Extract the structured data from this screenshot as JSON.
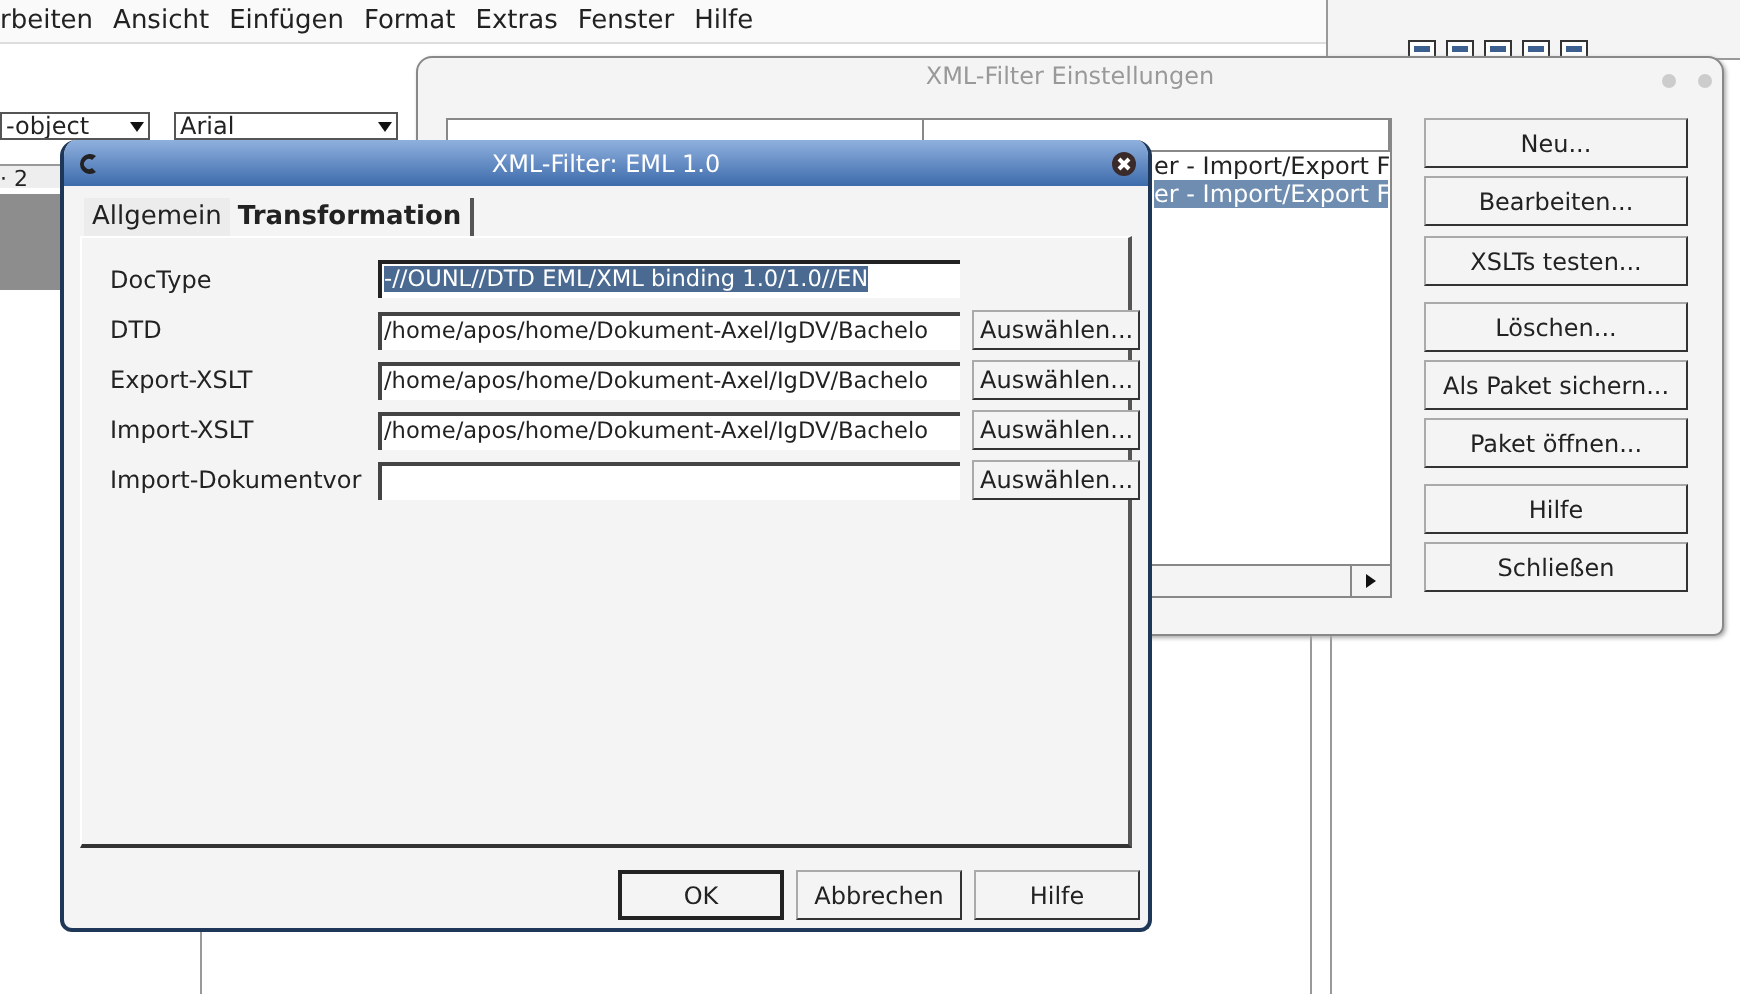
{
  "menu_bar": [
    {
      "label": "rbeiten"
    },
    {
      "label": "Ansicht"
    },
    {
      "label": "Einfügen"
    },
    {
      "label": "Format"
    },
    {
      "label": "Extras"
    },
    {
      "label": "Fenster"
    },
    {
      "label": "Hilfe"
    }
  ],
  "background_toolbar": {
    "style_box": "-object",
    "font_box": "Arial",
    "ruler": "· 2"
  },
  "filter_settings": {
    "title": "XML-Filter Einstellungen",
    "rows": [
      {
        "type": "er - Import/Export F",
        "selected": false
      },
      {
        "type": "er - Import/Export F",
        "selected": true
      }
    ],
    "buttons": [
      {
        "label": "Neu..."
      },
      {
        "label": "Bearbeiten..."
      },
      {
        "label": "XSLTs testen..."
      },
      {
        "label": "Löschen..."
      },
      {
        "label": "Als Paket sichern..."
      },
      {
        "label": "Paket öffnen..."
      },
      {
        "label": "Hilfe"
      },
      {
        "label": "Schließen"
      }
    ]
  },
  "filter_dialog": {
    "title": "XML-Filter: EML 1.0",
    "tabs": [
      {
        "label": "Allgemein",
        "selected": false
      },
      {
        "label": "Transformation",
        "selected": true
      }
    ],
    "fields": [
      {
        "label": "DocType",
        "value": "-//OUNL//DTD EML/XML binding 1.0/1.0//EN",
        "selected": true
      },
      {
        "label": "DTD",
        "value": "/home/apos/home/Dokument-Axel/IgDV/Bachelo",
        "selected": false,
        "button": {
          "label": "Auswählen..."
        }
      },
      {
        "label": "Export-XSLT",
        "value": "/home/apos/home/Dokument-Axel/IgDV/Bachelo",
        "selected": false,
        "button": {
          "label": "Auswählen..."
        }
      },
      {
        "label": "Import-XSLT",
        "value": "/home/apos/home/Dokument-Axel/IgDV/Bachelo",
        "selected": false,
        "button": {
          "label": "Auswählen..."
        }
      },
      {
        "label": "Import-Dokumentvor",
        "selected": false,
        "button": {
          "label": "Auswählen..."
        }
      }
    ],
    "buttons": [
      {
        "label": "OK",
        "default": true
      },
      {
        "label": "Abbrechen",
        "default": false
      },
      {
        "label": "Hilfe",
        "default": false
      }
    ]
  }
}
